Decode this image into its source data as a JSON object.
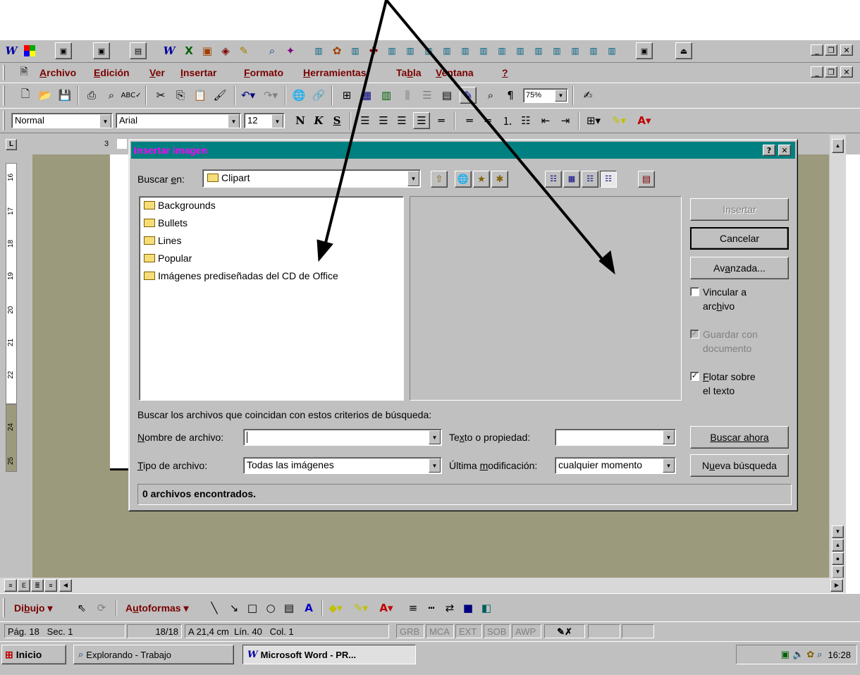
{
  "titlebar_controls": {
    "minimize": "_",
    "restore": "❐",
    "close": "✕"
  },
  "menu": [
    {
      "label": "Archivo",
      "ul": "A"
    },
    {
      "label": "Edición",
      "ul": "E"
    },
    {
      "label": "Ver",
      "ul": "V"
    },
    {
      "label": "Insertar",
      "ul": "I"
    },
    {
      "label": "Formato",
      "ul": "F"
    },
    {
      "label": "Herramientas",
      "ul": "H"
    },
    {
      "label": "Tabla",
      "ul": "b"
    },
    {
      "label": "Ventana",
      "ul": "V"
    },
    {
      "label": "?",
      "ul": "?"
    }
  ],
  "menu_text": {
    "archivo_rest": "rchivo",
    "edicion_rest": "dición",
    "ver_rest": "er",
    "insertar_rest": "nsertar",
    "formato_rest": "ormato",
    "herr_rest": "erramientas",
    "tabla_pre": "Ta",
    "tabla_rest": "la",
    "ventana_rest": "entana",
    "help": "?"
  },
  "standard_toolbar": {
    "zoom": "75%"
  },
  "format_toolbar": {
    "style": "Normal",
    "font": "Arial",
    "size": "12",
    "bold": "N",
    "italic": "K",
    "underline": "S"
  },
  "ruler": {
    "corner": "L",
    "top_mark": "3",
    "vertical_labels": [
      "16",
      "17",
      "18",
      "19",
      "20",
      "21",
      "22",
      "24",
      "25"
    ]
  },
  "dialog": {
    "title": "Insertar imagen",
    "help_btn": "?",
    "close_btn": "✕",
    "lookin_label_pre": "Buscar ",
    "lookin_label_ul": "e",
    "lookin_label_post": "n:",
    "lookin_value": "Clipart",
    "folders": [
      "Backgrounds",
      "Bullets",
      "Lines",
      "Popular",
      "Imágenes prediseñadas del CD de Office"
    ],
    "buttons": {
      "insert": "Insertar",
      "cancel": "Cancelar",
      "advanced_pre": "Av",
      "advanced_ul": "a",
      "advanced_post": "nzada...",
      "search_now": "Buscar ahora",
      "new_search_pre": "N",
      "new_search_ul": "u",
      "new_search_post": "eva búsqueda"
    },
    "checkboxes": {
      "link_line1": "Vincular a",
      "link_line2_pre": "arc",
      "link_line2_ul": "h",
      "link_line2_post": "ivo",
      "save_line1": "Guardar con",
      "save_line2": "documento",
      "float_line1_ul": "F",
      "float_line1_rest": "lotar sobre",
      "float_line2": "el texto"
    },
    "criteria_label": "Buscar los archivos que coincidan con estos criterios de búsqueda:",
    "filename_label_ul": "N",
    "filename_label_rest": "ombre de archivo:",
    "filename_value": "",
    "text_label_pre": "Te",
    "text_label_ul": "x",
    "text_label_post": "to o propiedad:",
    "text_value": "",
    "filetype_label_ul": "T",
    "filetype_label_rest": "ipo de archivo:",
    "filetype_value": "Todas las imágenes",
    "modified_label_pre": "Última ",
    "modified_label_ul": "m",
    "modified_label_post": "odificación:",
    "modified_value": "cualquier momento",
    "status": "0 archivos encontrados."
  },
  "drawing_toolbar": {
    "draw_pre": "Di",
    "draw_ul": "b",
    "draw_post": "ujo",
    "autoshapes_pre": "A",
    "autoshapes_ul": "u",
    "autoshapes_post": "toformas"
  },
  "statusbar": {
    "page": "Pág. 18",
    "section": "Sec. 1",
    "pages": "18/18",
    "at": "A 21,4 cm",
    "line": "Lín. 40",
    "col": "Col. 1",
    "grb": "GRB",
    "mca": "MCA",
    "ext": "EXT",
    "sob": "SOB",
    "awp": "AWP"
  },
  "taskbar": {
    "start": "Inicio",
    "task1": "Explorando - Trabajo",
    "task2": "Microsoft Word - PR...",
    "clock": "16:28"
  },
  "colors": {
    "dialog_title_bg": "#008080",
    "dialog_title_text": "#ff00ff",
    "doc_bg": "#9c9a7c",
    "face": "#c0c0c0"
  }
}
